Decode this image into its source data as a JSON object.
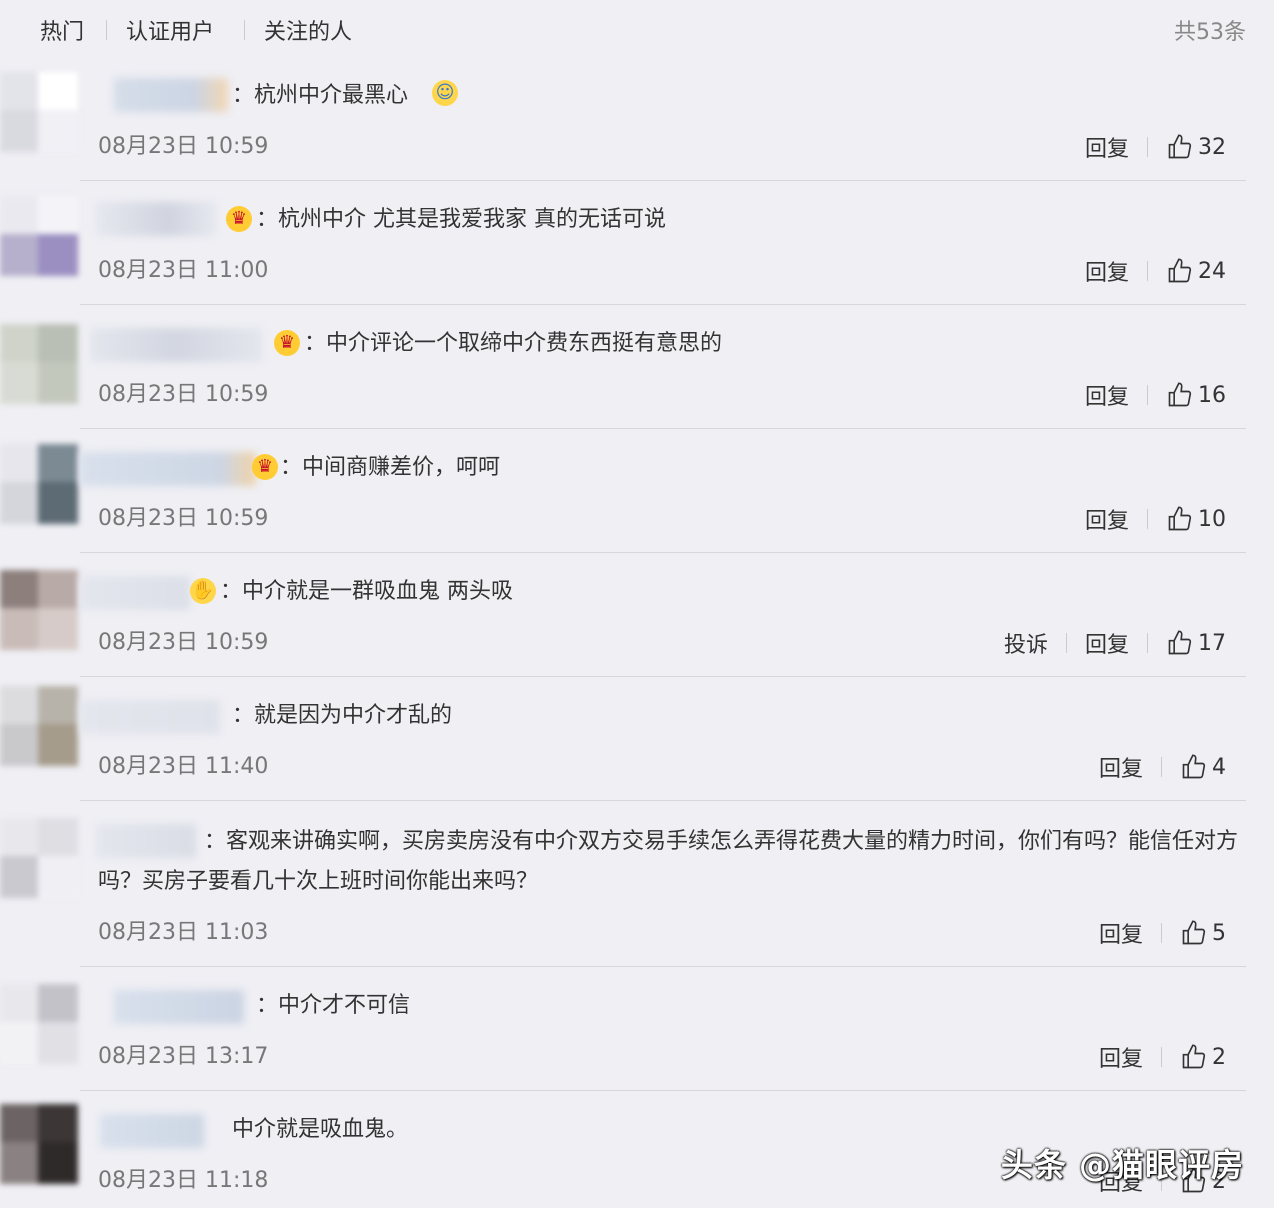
{
  "tabs": [
    "热门",
    "认证用户",
    "关注的人"
  ],
  "total": "共53条",
  "reply_label": "回复",
  "report_label": "投诉",
  "watermark": "头条 @猫眼评房",
  "comments": [
    {
      "text": "：杭州中介最黑心",
      "time": "08月23日 10:59",
      "likes": "32"
    },
    {
      "text": "：杭州中介 尤其是我爱我家 真的无话可说",
      "time": "08月23日 11:00",
      "likes": "24"
    },
    {
      "text": "：中介评论一个取缔中介费东西挺有意思的",
      "time": "08月23日 10:59",
      "likes": "16"
    },
    {
      "text": "：中间商赚差价，呵呵",
      "time": "08月23日 10:59",
      "likes": "10"
    },
    {
      "text": "：中介就是一群吸血鬼 两头吸",
      "time": "08月23日 10:59",
      "likes": "17"
    },
    {
      "text": "：就是因为中介才乱的",
      "time": "08月23日 11:40",
      "likes": "4"
    },
    {
      "text": "：客观来讲确实啊，买房卖房没有中介双方交易手续怎么弄得花费大量的精力时间，你们有吗？能信任对方吗？买房子要看几十次上班时间你能出来吗？",
      "time": "08月23日 11:03",
      "likes": "5"
    },
    {
      "text": "：中介才不可信",
      "time": "08月23日 13:17",
      "likes": "2"
    },
    {
      "text": "中介就是吸血鬼。",
      "time": "08月23日 11:18",
      "likes": "2"
    }
  ]
}
